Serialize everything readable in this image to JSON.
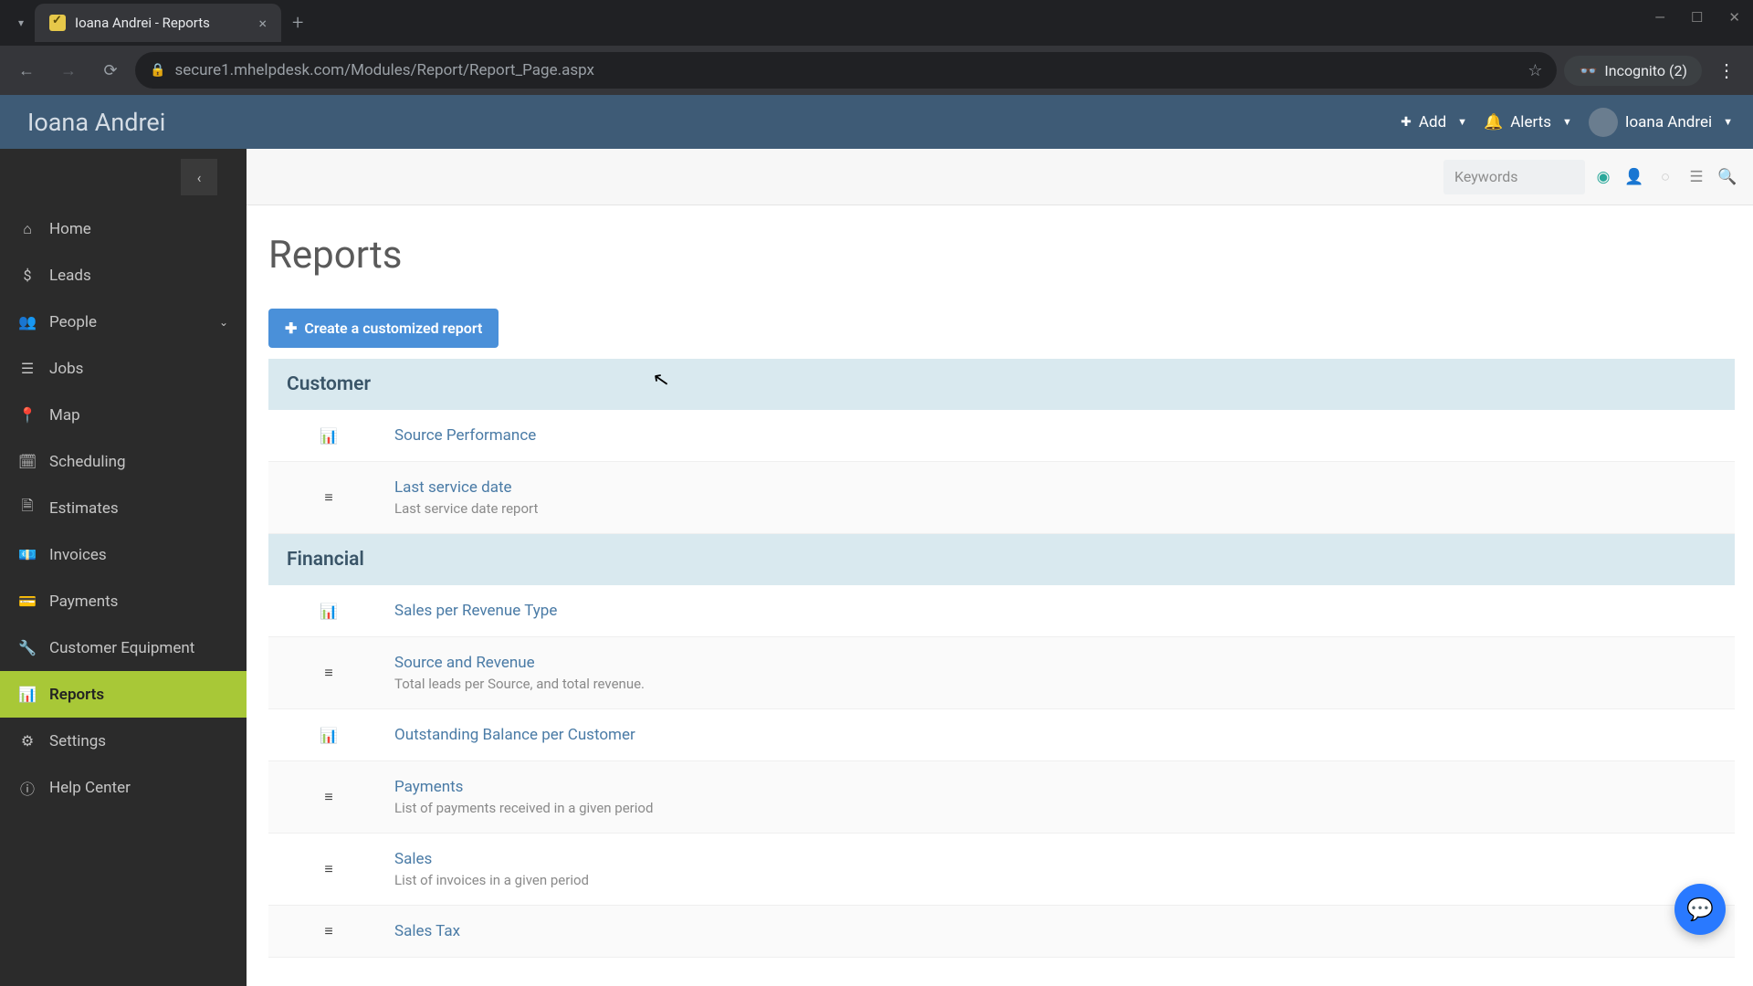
{
  "browser": {
    "tab_title": "Ioana Andrei - Reports",
    "url": "secure1.mhelpdesk.com/Modules/Report/Report_Page.aspx",
    "incognito_label": "Incognito (2)"
  },
  "header": {
    "app_name": "Ioana Andrei",
    "add_label": "Add",
    "alerts_label": "Alerts",
    "user_name": "Ioana Andrei"
  },
  "sidebar": {
    "items": [
      {
        "icon": "⌂",
        "label": "Home"
      },
      {
        "icon": "$",
        "label": "Leads"
      },
      {
        "icon": "👥",
        "label": "People",
        "expandable": true
      },
      {
        "icon": "☰",
        "label": "Jobs"
      },
      {
        "icon": "📍",
        "label": "Map"
      },
      {
        "icon": "🗓",
        "label": "Scheduling"
      },
      {
        "icon": "🗎",
        "label": "Estimates"
      },
      {
        "icon": "💶",
        "label": "Invoices"
      },
      {
        "icon": "💳",
        "label": "Payments"
      },
      {
        "icon": "🔧",
        "label": "Customer Equipment"
      },
      {
        "icon": "📊",
        "label": "Reports",
        "active": true
      },
      {
        "icon": "⚙",
        "label": "Settings"
      },
      {
        "icon": "ⓘ",
        "label": "Help Center"
      }
    ]
  },
  "toolbar": {
    "search_placeholder": "Keywords"
  },
  "page": {
    "title": "Reports",
    "create_label": "Create a customized report"
  },
  "sections": [
    {
      "title": "Customer",
      "reports": [
        {
          "icon": "chart",
          "title": "Source Performance",
          "desc": ""
        },
        {
          "icon": "list",
          "title": "Last service date",
          "desc": "Last service date report"
        }
      ]
    },
    {
      "title": "Financial",
      "reports": [
        {
          "icon": "chart",
          "title": "Sales per Revenue Type",
          "desc": ""
        },
        {
          "icon": "list",
          "title": "Source and Revenue",
          "desc": "Total leads per Source, and total revenue."
        },
        {
          "icon": "chart",
          "title": "Outstanding Balance per Customer",
          "desc": ""
        },
        {
          "icon": "list",
          "title": "Payments",
          "desc": "List of payments received in a given period"
        },
        {
          "icon": "list",
          "title": "Sales",
          "desc": "List of invoices in a given period"
        },
        {
          "icon": "list",
          "title": "Sales Tax",
          "desc": ""
        }
      ]
    }
  ]
}
